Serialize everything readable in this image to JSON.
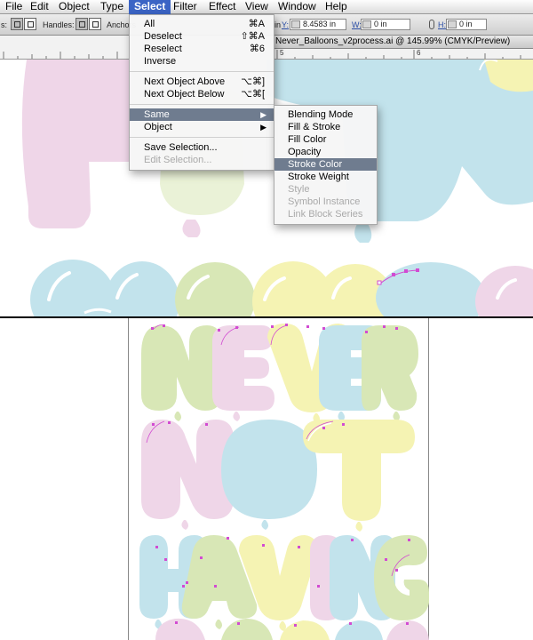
{
  "menubar": {
    "items": [
      "File",
      "Edit",
      "Object",
      "Type",
      "Select",
      "Filter",
      "Effect",
      "View",
      "Window",
      "Help"
    ],
    "active": "Select"
  },
  "control_bar": {
    "handles_label": "Handles:",
    "anchors_label": "Anchors",
    "y_label": "Y:",
    "y_value": "8.4583 in",
    "w_label": "W:",
    "w_value": "0 in",
    "h_label": "H:",
    "h_value": "0 in",
    "x_value_fragment": "in"
  },
  "document": {
    "title": "Never_Balloons_v2process.ai @ 145.99% (CMYK/Preview)"
  },
  "ruler": {
    "numbers": [
      "5",
      "6"
    ]
  },
  "select_menu": {
    "items": [
      {
        "label": "All",
        "shortcut": "⌘A"
      },
      {
        "label": "Deselect",
        "shortcut": "⇧⌘A"
      },
      {
        "label": "Reselect",
        "shortcut": "⌘6"
      },
      {
        "label": "Inverse",
        "shortcut": ""
      },
      {
        "label": "Next Object Above",
        "shortcut": "⌥⌘]"
      },
      {
        "label": "Next Object Below",
        "shortcut": "⌥⌘["
      },
      {
        "label": "Same",
        "shortcut": ""
      },
      {
        "label": "Object",
        "shortcut": ""
      },
      {
        "label": "Save Selection...",
        "shortcut": ""
      },
      {
        "label": "Edit Selection...",
        "shortcut": ""
      }
    ],
    "highlighted": "Same"
  },
  "same_submenu": {
    "items": [
      {
        "label": "Blending Mode",
        "enabled": true
      },
      {
        "label": "Fill & Stroke",
        "enabled": true
      },
      {
        "label": "Fill Color",
        "enabled": true
      },
      {
        "label": "Opacity",
        "enabled": true
      },
      {
        "label": "Stroke Color",
        "enabled": true
      },
      {
        "label": "Stroke Weight",
        "enabled": true
      },
      {
        "label": "Style",
        "enabled": false
      },
      {
        "label": "Symbol Instance",
        "enabled": false
      },
      {
        "label": "Link Block Series",
        "enabled": false
      }
    ],
    "highlighted": "Stroke Color"
  },
  "artwork": {
    "words": [
      "NEVER",
      "NOT",
      "HAVING"
    ],
    "colors": {
      "pink": "#efd6e8",
      "blue": "#c2e3ec",
      "green": "#d8e7b6",
      "yellow": "#f5f3b3",
      "anchor": "#d24bd2"
    }
  },
  "icons": [
    "handles-corner-icon",
    "handles-smooth-icon",
    "chain-link-icon",
    "submenu-arrow-icon"
  ]
}
